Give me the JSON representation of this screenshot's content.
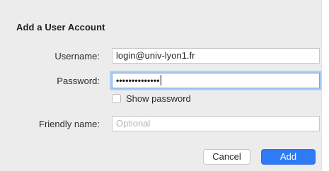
{
  "dialog": {
    "title": "Add a User Account",
    "username_label": "Username:",
    "username_value": "login@univ-lyon1.fr",
    "password_label": "Password:",
    "password_masked": "••••••••••••••",
    "show_password_label": "Show password",
    "show_password_checked": false,
    "friendly_name_label": "Friendly name:",
    "friendly_name_placeholder": "Optional",
    "cancel_label": "Cancel",
    "add_label": "Add",
    "colors": {
      "background": "#ececec",
      "primary_button": "#2f7bf6",
      "focus_ring": "#a9c9f4"
    }
  }
}
